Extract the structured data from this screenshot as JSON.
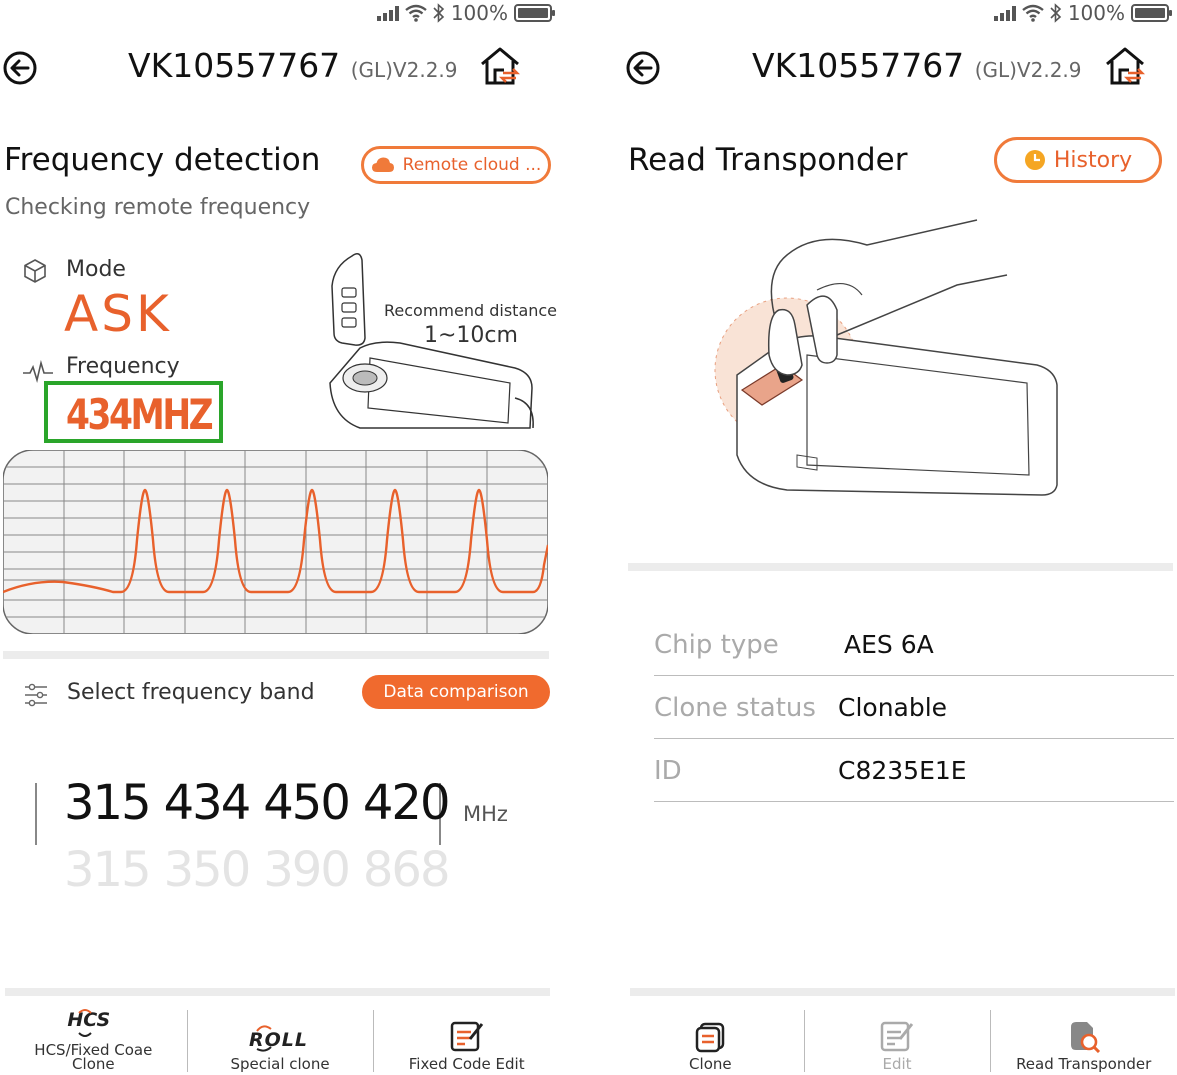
{
  "status_bar": {
    "battery": "100%"
  },
  "left": {
    "header": {
      "device_id": "VK10557767",
      "version": "(GL)V2.2.9"
    },
    "section_title": "Frequency detection",
    "subtitle": "Checking remote frequency",
    "remote_cloud_button": "Remote cloud ...",
    "mode_label": "Mode",
    "mode_value": "ASK",
    "frequency_label": "Frequency",
    "frequency_value": "434MHZ",
    "recommend_label": "Recommend distance",
    "recommend_value": "1~10cm",
    "select_band_label": "Select frequency band",
    "data_comparison_button": "Data comparison",
    "bands_active": [
      "315",
      "434",
      "450",
      "420"
    ],
    "bands_inactive": [
      "315",
      "350",
      "390",
      "868"
    ],
    "unit": "MHz",
    "nav": [
      {
        "label": "HCS/Fixed Coae Clone",
        "icon": "hcs-icon"
      },
      {
        "label": "Special clone",
        "icon": "roll-icon"
      },
      {
        "label": "Fixed Code Edit",
        "icon": "edit-doc-icon"
      }
    ],
    "logo_text": {
      "hcs": "HCS",
      "roll": "ROLL"
    }
  },
  "right": {
    "header": {
      "device_id": "VK10557767",
      "version": "(GL)V2.2.9"
    },
    "section_title": "Read Transponder",
    "history_button": "History",
    "info": [
      {
        "key": "Chip type",
        "value": "AES 6A"
      },
      {
        "key": "Clone status",
        "value": "Clonable"
      },
      {
        "key": "ID",
        "value": "C8235E1E"
      }
    ],
    "nav": [
      {
        "label": "Clone",
        "icon": "clone-icon"
      },
      {
        "label": "Edit",
        "icon": "edit-icon"
      },
      {
        "label": "Read Transponder",
        "icon": "read-transponder-icon"
      }
    ]
  },
  "colors": {
    "accent": "#f06a2e",
    "highlight_box": "#2aa52a",
    "wave": "#e8612c"
  }
}
